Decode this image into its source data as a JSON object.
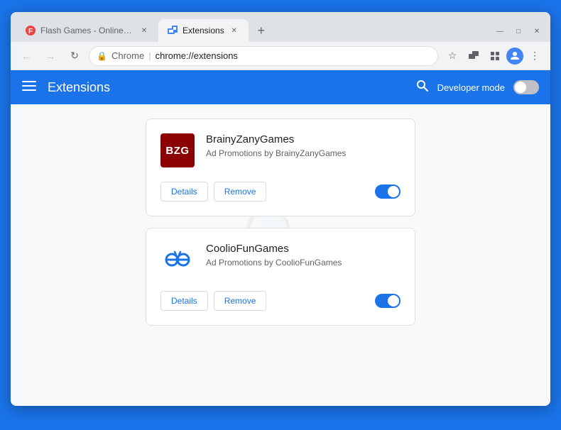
{
  "browser": {
    "window_controls": {
      "minimize": "—",
      "maximize": "□",
      "close": "✕"
    },
    "tabs": [
      {
        "id": "tab1",
        "title": "Flash Games - Online Flash Gam",
        "favicon_color": "#e84545",
        "active": false
      },
      {
        "id": "tab2",
        "title": "Extensions",
        "active": true
      }
    ],
    "new_tab_label": "+",
    "nav": {
      "back_disabled": true,
      "forward_disabled": true,
      "reload": "↻",
      "site_name": "Chrome",
      "url": "chrome://extensions"
    }
  },
  "extensions_page": {
    "header": {
      "menu_icon": "☰",
      "title": "Extensions",
      "search_icon": "🔍",
      "developer_mode_label": "Developer mode"
    },
    "developer_mode_on": false,
    "extensions": [
      {
        "id": "bzg",
        "icon_text": "BZG",
        "icon_bg": "#8b0000",
        "name": "BrainyZanyGames",
        "description": "Ad Promotions by BrainyZanyGames",
        "details_label": "Details",
        "remove_label": "Remove",
        "enabled": true
      },
      {
        "id": "coolio",
        "icon_emoji": "👓",
        "name": "CoolioFunGames",
        "description": "Ad Promotions by CoolioFunGames",
        "details_label": "Details",
        "remove_label": "Remove",
        "enabled": true
      }
    ]
  }
}
